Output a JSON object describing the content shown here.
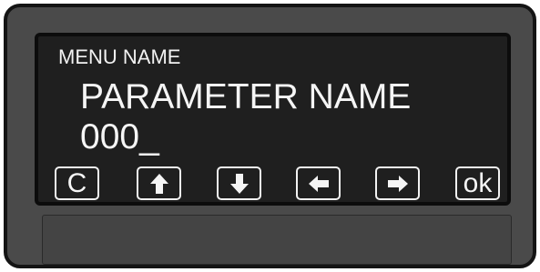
{
  "display": {
    "menu_name": "MENU NAME",
    "parameter_name": "PARAMETER NAME",
    "parameter_value": "000_"
  },
  "buttons": {
    "clear_label": "C",
    "up_icon": "arrow-up-icon",
    "down_icon": "arrow-down-icon",
    "left_icon": "arrow-left-icon",
    "right_icon": "arrow-right-icon",
    "ok_label": "ok"
  },
  "colors": {
    "bezel": "#4a4a4a",
    "screen": "#1f1f1f",
    "text": "#f5f5f5"
  }
}
